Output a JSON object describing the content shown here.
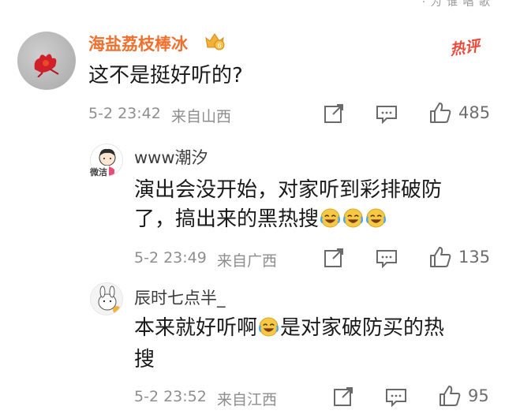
{
  "top_partial_text": "· 为 谁 唱 歌",
  "comment": {
    "username": "海盐荔枝棒冰",
    "vip_badge": "6",
    "hot_tag": "热评",
    "text": "这不是挺好听的?",
    "date": "5-2 23:42",
    "location": "来自山西",
    "likes": "485"
  },
  "replies": [
    {
      "username": "www潮汐",
      "avatar_caption": "微洁",
      "text_line1": "演出会没开始，对家听到彩排破防",
      "text_line2": "了，搞出来的黑热搜",
      "emoji": "laughing-crying-emoji",
      "date": "5-2 23:49",
      "location": "来自广西",
      "likes": "135"
    },
    {
      "username": "辰时七点半_",
      "text_line1_a": "本来就好听啊",
      "text_line1_b": "是对家破防买的热",
      "text_line2": "搜",
      "date": "5-2 23:52",
      "location": "来自江西",
      "likes": "95"
    }
  ],
  "colors": {
    "username_accent": "#f0702f",
    "hot_tag": "#e94a3c",
    "meta_gray": "#8e8e8e",
    "emoji_yellow": "#f6c945"
  }
}
